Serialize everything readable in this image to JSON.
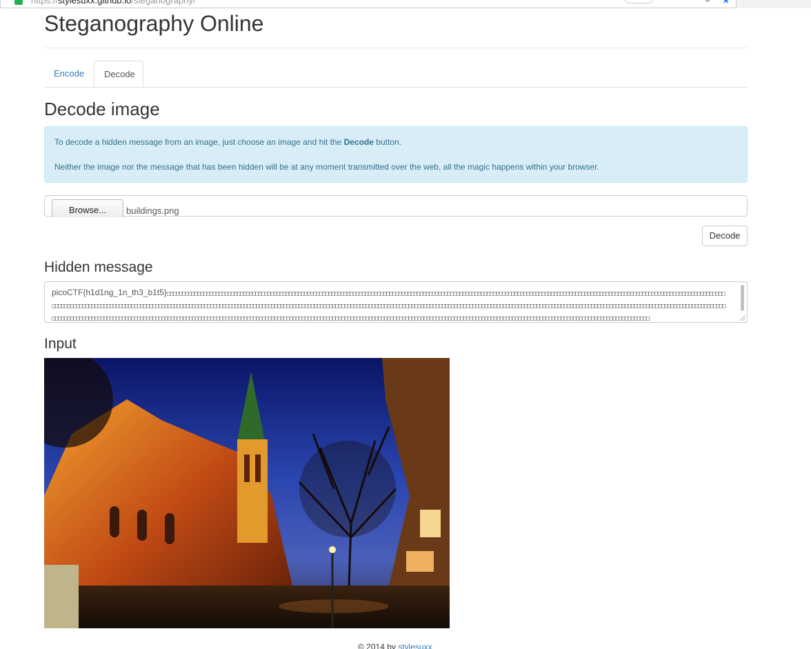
{
  "browser": {
    "url_prefix": "https://",
    "url_host": "stylesuxx.github.io",
    "url_path": "/steganography/"
  },
  "page": {
    "title": "Steganography Online"
  },
  "tabs": [
    {
      "label": "Encode",
      "active": false
    },
    {
      "label": "Decode",
      "active": true
    }
  ],
  "decode": {
    "heading": "Decode image",
    "info_line1_pre": "To decode a hidden message from an image, just choose an image and hit the ",
    "info_line1_bold": "Decode",
    "info_line1_post": " button.",
    "info_line2": "Neither the image nor the message that has been hidden will be at any moment transmitted over the web, all the magic happens within your browser.",
    "browse_label": "Browse...",
    "file_name": "buildings.png",
    "decode_button": "Decode"
  },
  "hidden_message": {
    "heading": "Hidden message",
    "text": "picoCTF{h1d1ng_1n_th3_b1t5}"
  },
  "input_section": {
    "heading": "Input"
  },
  "footer": {
    "prefix": "© 2014 by ",
    "link": "stylesuxx"
  },
  "colors": {
    "link": "#337ab7",
    "info_bg": "#d9edf7",
    "info_text": "#31708f"
  }
}
